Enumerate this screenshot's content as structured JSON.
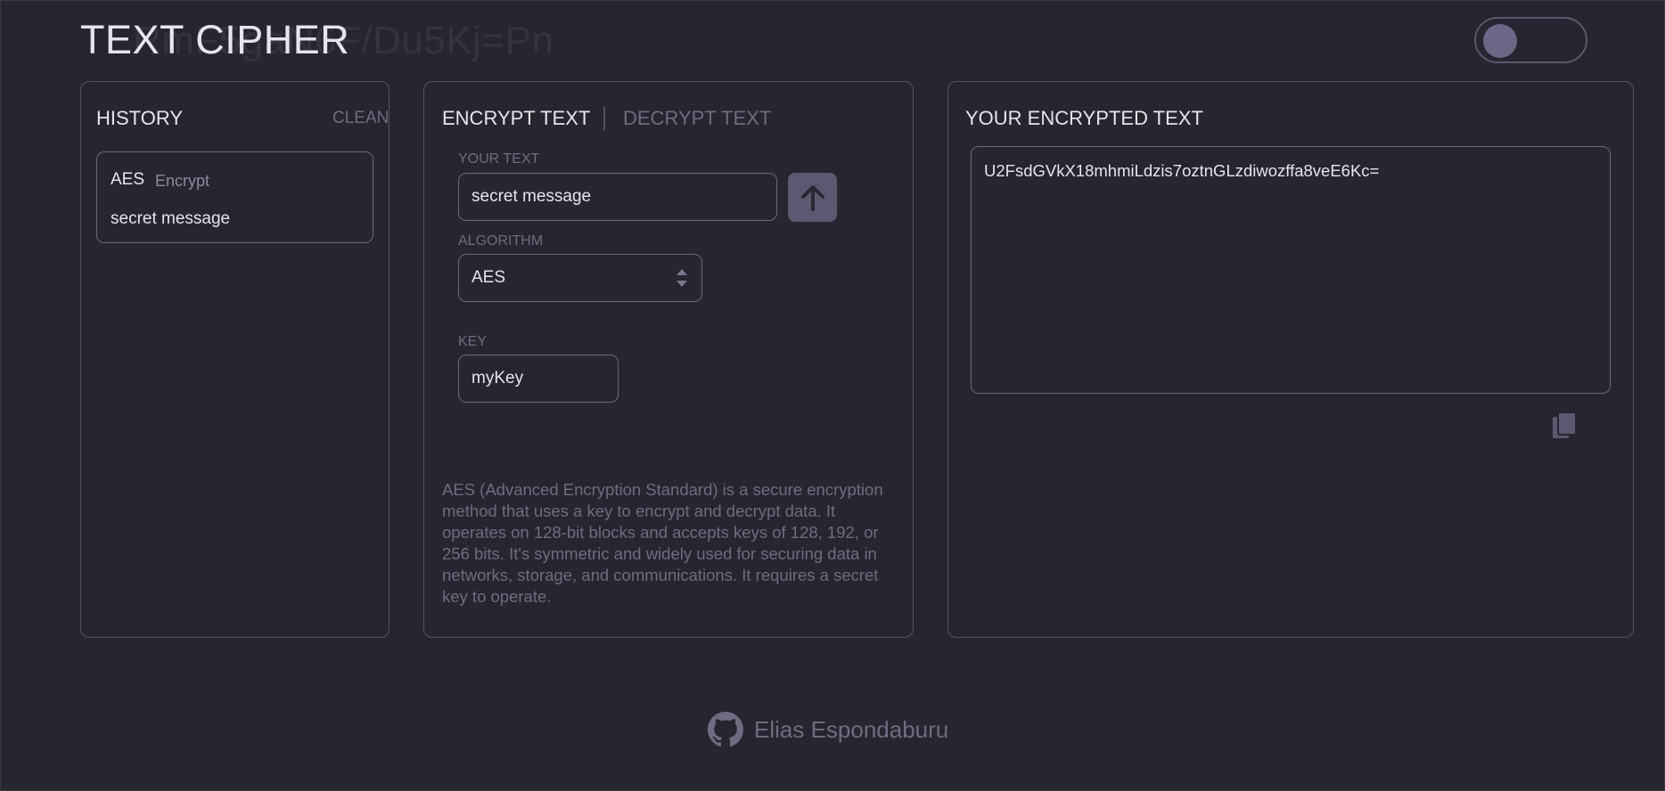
{
  "app": {
    "title": "TEXT CIPHER",
    "background_cipher": "RmF5gaN6F/Du5Kj=Pn"
  },
  "history": {
    "title": "HISTORY",
    "clean_label": "CLEAN",
    "items": [
      {
        "algorithm": "AES",
        "mode": "Encrypt",
        "text": "secret message"
      }
    ]
  },
  "encrypt": {
    "tabs": [
      {
        "label": "ENCRYPT TEXT",
        "active": true
      },
      {
        "label": "DECRYPT TEXT",
        "active": false
      }
    ],
    "text_label": "YOUR TEXT",
    "text_value": "secret message",
    "algorithm_label": "ALGORITHM",
    "algorithm_value": "AES",
    "key_label": "KEY",
    "key_value": "myKey",
    "description": "AES (Advanced Encryption Standard) is a secure encryption method that uses a key to encrypt and decrypt data. It operates on 128-bit blocks and accepts keys of 128, 192, or 256 bits. It's symmetric and widely used for securing data in networks, storage, and communications. It requires a secret key to operate."
  },
  "output": {
    "title": "YOUR ENCRYPTED TEXT",
    "value": "U2FsdGVkX18mhmiLdzis7oztnGLzdiwozffa8veE6Kc="
  },
  "footer": {
    "author": "Elias Espondaburu",
    "icon": "github-icon"
  },
  "colors": {
    "background": "#27252f",
    "border": "#55526a",
    "muted_text": "#6f6b82",
    "accent": "#5b5872"
  },
  "icons": {
    "submit": "arrow-up-icon",
    "copy": "copy-icon",
    "select": "select-arrows-icon",
    "theme": "theme-toggle"
  }
}
